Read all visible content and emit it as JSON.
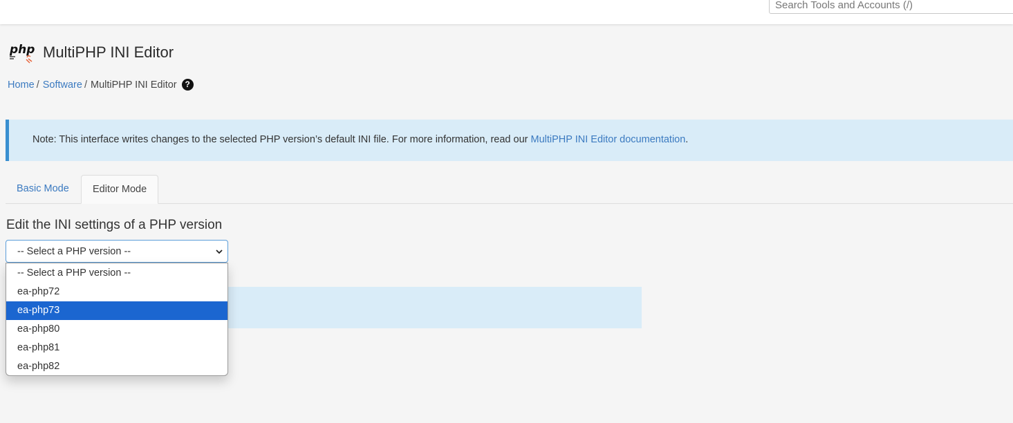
{
  "search": {
    "placeholder": "Search Tools and Accounts (/)"
  },
  "page": {
    "title": "MultiPHP INI Editor"
  },
  "breadcrumb": {
    "home": "Home",
    "sep": "/",
    "software": "Software",
    "current": "MultiPHP INI Editor",
    "help": "?"
  },
  "note": {
    "text": "Note: This interface writes changes to the selected PHP version’s default INI file. For more information, read our ",
    "link": "MultiPHP INI Editor documentation",
    "end": "."
  },
  "tabs": {
    "basic": "Basic Mode",
    "editor": "Editor Mode"
  },
  "section": {
    "title": "Edit the INI settings of a PHP version"
  },
  "select": {
    "value": "-- Select a PHP version --",
    "options": [
      "-- Select a PHP version --",
      "ea-php72",
      "ea-php73",
      "ea-php80",
      "ea-php81",
      "ea-php82"
    ],
    "highlighted": "ea-php73"
  },
  "colors": {
    "link": "#3b7ac0",
    "note_bg": "#d9ecf8",
    "highlight": "#1b66d0"
  }
}
